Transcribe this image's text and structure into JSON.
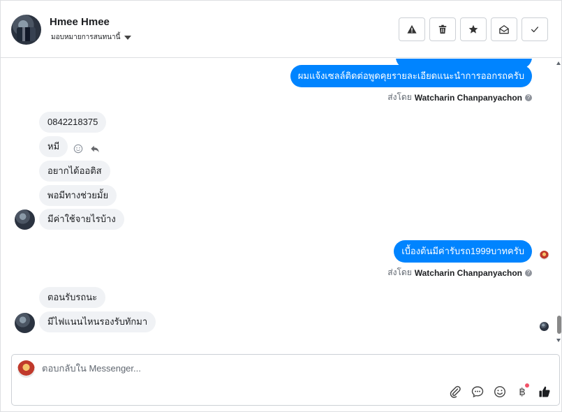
{
  "header": {
    "contact_name": "Hmee Hmee",
    "assign_label": "มอบหมายการสนทนานี้",
    "actions": [
      "spam-icon",
      "trash-icon",
      "star-icon",
      "mark-unread-icon",
      "done-icon"
    ]
  },
  "messages": {
    "out_1": "ผมแจ้งเซลล์ติดต่อพูดคุยรายละเอียดแนะนำการออกรถครับ",
    "sent_by_1_prefix": "ส่งโดย",
    "sent_by_1_name": "Watcharin Chanpanyachon",
    "in_1": "0842218375",
    "in_2": "หมี",
    "in_3": "อยากได้ออติส",
    "in_4": "พอมีทางช่วยมั้ย",
    "in_5": "มีค่าใช้จายไรบ้าง",
    "out_2": "เบื้องต้นมีค่ารับรถ1999บาทครับ",
    "sent_by_2_prefix": "ส่งโดย",
    "sent_by_2_name": "Watcharin Chanpanyachon",
    "in_6": "ตอนรับรถนะ",
    "in_7": "มีไฟแนนไหนรองรับทักมา"
  },
  "composer": {
    "placeholder": "ตอบกลับใน Messenger...",
    "tools": [
      "attachment-icon",
      "saved-reply-icon",
      "emoji-icon",
      "baht-icon",
      "like-icon"
    ],
    "baht_symbol": "฿"
  },
  "colors": {
    "outgoing_bubble": "#0084ff",
    "incoming_bubble": "#f0f2f5",
    "notification_dot": "#f25268"
  }
}
